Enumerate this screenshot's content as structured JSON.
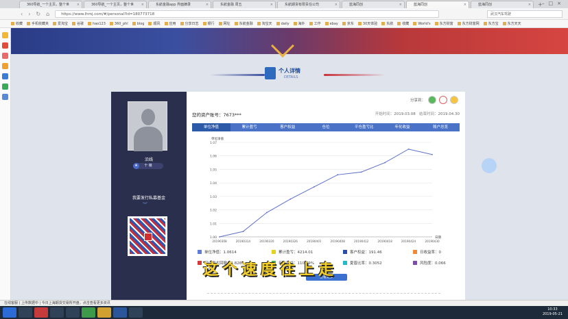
{
  "browser": {
    "tabs": [
      {
        "label": "360导航_一个主页，整个世",
        "active": false
      },
      {
        "label": "360导航_一个主页，整个世",
        "active": false
      },
      {
        "label": "东航金融app 界面摘录",
        "active": false
      },
      {
        "label": "东航金融 周五",
        "active": false
      },
      {
        "label": "东航期货有限责任公司",
        "active": false
      },
      {
        "label": "蓝海同创",
        "active": false
      },
      {
        "label": "蓝海同创",
        "active": true
      },
      {
        "label": "蓝海同创",
        "active": false
      }
    ],
    "url": "https://www.lhmj.com/#/personal?id=180773718",
    "search_placeholder": "武汉汽车驾驶",
    "bookmarks": [
      "收藏",
      "手机收藏夹",
      "爱淘宝",
      "谷歌",
      "hao123",
      "360_phl",
      "blog",
      "顺风",
      "应用",
      "分享日志",
      "银行",
      "网址",
      "东航金融",
      "淘宝天",
      "daily",
      "海外",
      "工作",
      "ebay",
      "京东",
      "30天体验",
      "东航",
      "收藏",
      "World's",
      "东方财富",
      "东方财富网",
      "东方宝",
      "东方天天"
    ]
  },
  "page": {
    "section_title": "个人详情",
    "section_subtitle": "DETAILS",
    "profile": {
      "name": "沿线",
      "level": "十 级",
      "fund_title": "我要发行私募基金"
    },
    "share_label": "分享到：",
    "account_label": "您的资产账号：7673***",
    "start_label": "开始时间：",
    "start_date": "2019.03.08",
    "end_label": "结束时间：",
    "end_date": "2019.04.30",
    "tabs": [
      "单位净值",
      "累计盈亏",
      "客户权益",
      "仓位",
      "平仓盈亏比",
      "年化收益",
      "账户总览"
    ],
    "legend": [
      {
        "label": "单位净值：1.0614",
        "color": "#5b7fd6"
      },
      {
        "label": "累计盈亏：4214.01",
        "color": "#e6d020"
      },
      {
        "label": "客户权益：191.46",
        "color": "#2c4ea8"
      },
      {
        "label": "日收益率：0",
        "color": "#f08a3a"
      },
      {
        "label": "可以最大回撤：1.8269",
        "color": "#d23b3b"
      },
      {
        "label": "年化收益：110.79%",
        "color": "#4caf50"
      },
      {
        "label": "夏普比率：0.3052",
        "color": "#29b6c8"
      },
      {
        "label": "风险度：0.066",
        "color": "#7b4fae"
      }
    ],
    "action_button": "查看更多",
    "subtitle_text": "这个速度往上走"
  },
  "chart_data": {
    "type": "line",
    "title": "",
    "ylabel": "单位净值",
    "xlabel": "日期",
    "x": [
      "20190308",
      "20190314",
      "20190320",
      "20190326",
      "20190401",
      "20190408",
      "20190412",
      "20190418",
      "20190424",
      "20190430"
    ],
    "series": [
      {
        "name": "单位净值",
        "values": [
          1.0,
          1.004,
          1.018,
          1.028,
          1.037,
          1.046,
          1.048,
          1.055,
          1.065,
          1.061
        ]
      }
    ],
    "ylim": [
      1.0,
      1.07
    ],
    "yticks": [
      "1.00",
      "1.01",
      "1.02",
      "1.03",
      "1.04",
      "1.05",
      "1.06",
      "1.07"
    ],
    "grid": true
  },
  "statusbar": "在线客服 | 上传数据中 | 今日上海期货交易所开盘，点击查看更多资讯",
  "taskbar": {
    "time": "10:33",
    "date": "2019-05-21"
  }
}
